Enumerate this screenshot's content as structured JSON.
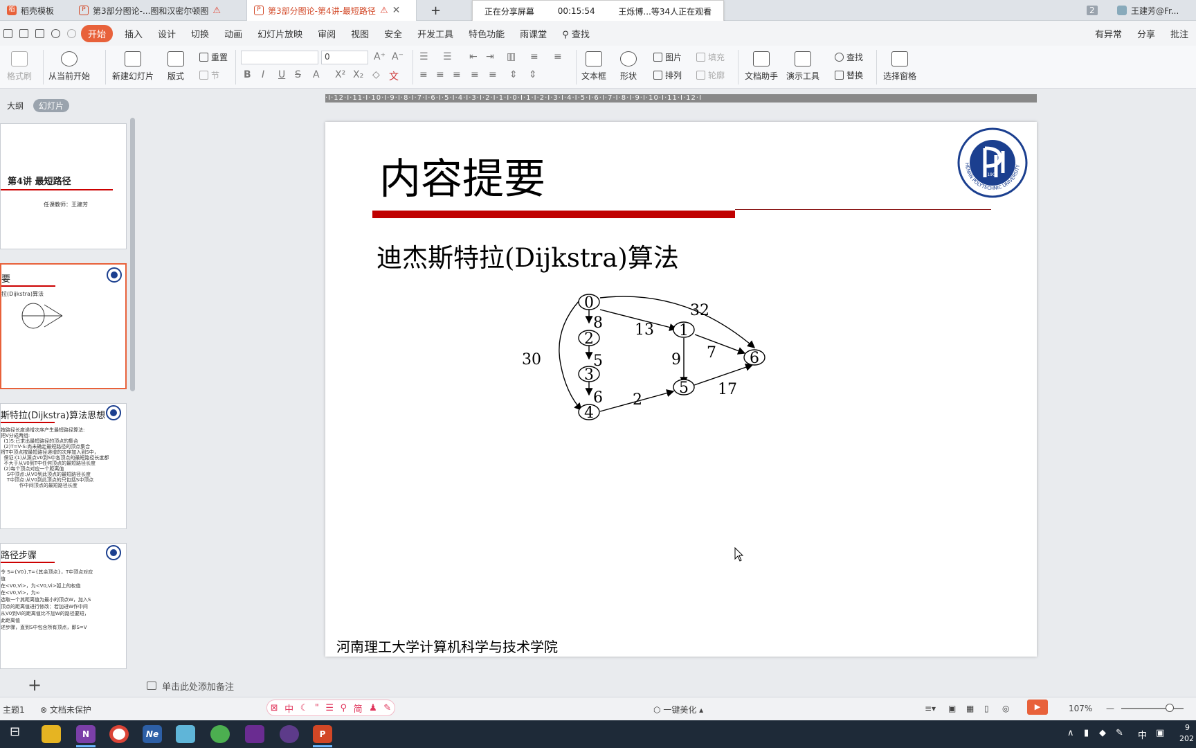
{
  "tabs": [
    {
      "label": "稻壳模板",
      "warning": ""
    },
    {
      "label": "第3部分图论-...图和汉密尔顿图",
      "warning": "⚠"
    },
    {
      "label": "第3部分图论-第4讲-最短路径",
      "warning": "⚠",
      "close": "✕"
    }
  ],
  "new_tab": "+",
  "share": {
    "status": "正在分享屏幕",
    "timer": "00:15:54",
    "viewers": "王烁博...等34人正在观看"
  },
  "window": {
    "badge": "2",
    "user": "王建芳@Fr..."
  },
  "menu": {
    "items": [
      "开始",
      "插入",
      "设计",
      "切换",
      "动画",
      "幻灯片放映",
      "审阅",
      "视图",
      "安全",
      "开发工具",
      "特色功能",
      "雨课堂"
    ],
    "search": "查找",
    "right": [
      "有异常",
      "分享",
      "批注"
    ]
  },
  "ribbon": {
    "paste_fmt": "格式刷",
    "from_current": "从当前开始",
    "new_slide": "新建幻灯片",
    "layout": "版式",
    "reset": "重置",
    "section": "节",
    "font_size": "0",
    "textbox": "文本框",
    "shape": "形状",
    "picture": "图片",
    "fill": "填充",
    "arrange": "排列",
    "outline": "轮廓",
    "doc_helper": "文档助手",
    "present_tools": "演示工具",
    "find": "查找",
    "replace": "替换",
    "select_pane": "选择窗格"
  },
  "ruler_text": "·I·12·I·11·I·10·I·9·I·8·I·7·I·6·I·5·I·4·I·3·I·2·I·1·I·0·I·1·I·2·I·3·I·4·I·5·I·6·I·7·I·8·I·9·I·10·I·11·I·12·I",
  "left_panel": {
    "view_tabs": [
      "大纲",
      "幻灯片"
    ],
    "thumbs": [
      {
        "title": "第4讲 最短路径",
        "lines": "任课教师：王建芳"
      },
      {
        "title": "要",
        "lines": "拉(Dijkstra)算法"
      },
      {
        "title": "斯特拉(Dijkstra)算法思想",
        "lines": "按路径长度递增次序产生最短路径算法:\n把V分成两组:\n  (1)S:已求出最短路径的顶点的集合\n  (2)T=V-S:尚未确定最短路径的顶点集合\n将T中顶点按最短路径递增的次序加入到S中，\n  保证:(1)从源点V0到S中各顶点的最短路径长度都\n  不大于从V0到T中任何顶点的最短路径长度\n  (2)每个顶点对应一个距离值\n    S中顶点:从V0到此顶点的最短路径长度\n    T中顶点:从V0到此顶点的只包括S中顶点\n            作中间顶点的最短路径长度"
      },
      {
        "title": "路径步骤",
        "lines": "令 S={V0},T={其余顶点}，T中顶点对应\n值\n在<V0,Vi>，为<V0,Vi>弧上的权值\n在<V0,Vi>，为∞\n选取一个其距离值为最小的顶点W，加入S\n顶点的距离值进行修改：若加进W作中间\n从V0到Vi的距离值比不加W的路径要短，\n此距离值\n述步骤，直到S中包含所有顶点，即S=V"
      }
    ],
    "add": "+"
  },
  "slide": {
    "title": "内容提要",
    "heading": "迪杰斯特拉(Dijkstra)算法",
    "footer": "河南理工大学计算机科学与技术学院",
    "logo_text": "HENAN POLYTECHNIC UNIVERSITY",
    "logo_year": "1909",
    "graph": {
      "nodes": [
        "0",
        "1",
        "2",
        "3",
        "4",
        "5",
        "6"
      ],
      "edge_weights": [
        "8",
        "13",
        "32",
        "5",
        "9",
        "7",
        "30",
        "6",
        "2",
        "17"
      ]
    }
  },
  "notes_placeholder": "单击此处添加备注",
  "status": {
    "theme": "主题1",
    "protect": "文档未保护",
    "ime": [
      "中",
      "简"
    ],
    "beautify": "一键美化",
    "zoom": "107%"
  },
  "taskbar": {
    "apps": [
      "N",
      "Ne",
      "P"
    ],
    "tray": [
      "中"
    ],
    "clock_time": "9",
    "clock_date": "202"
  }
}
